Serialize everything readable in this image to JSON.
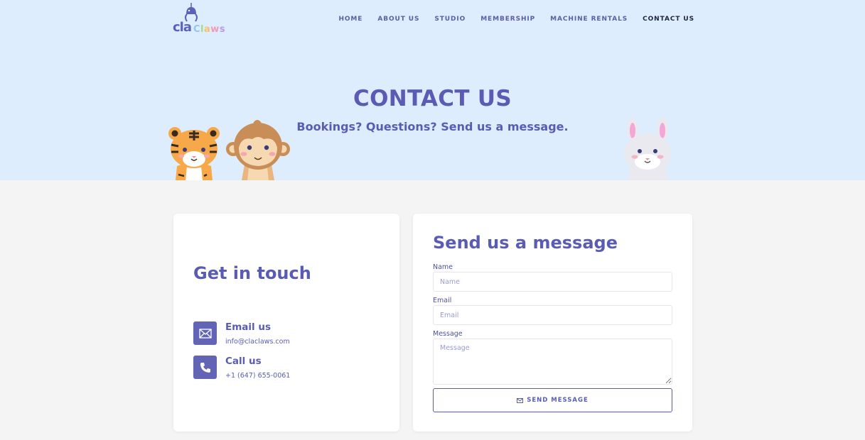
{
  "brand": {
    "logo_part1": "cla",
    "logo_part2_letters": [
      "C",
      "l",
      "a",
      "w",
      "s"
    ]
  },
  "nav": {
    "items": [
      {
        "label": "HOME"
      },
      {
        "label": "ABOUT US"
      },
      {
        "label": "STUDIO"
      },
      {
        "label": "MEMBERSHIP"
      },
      {
        "label": "MACHINE RENTALS"
      },
      {
        "label": "CONTACT US",
        "active": true
      }
    ]
  },
  "hero": {
    "title": "CONTACT US",
    "subtitle": "Bookings? Questions? Send us a message."
  },
  "get_in_touch": {
    "title": "Get in touch",
    "email": {
      "title": "Email us",
      "value": "info@claclaws.com",
      "icon": "envelope-icon"
    },
    "phone": {
      "title": "Call us",
      "value": "+1 (647) 655-0061",
      "icon": "phone-icon"
    }
  },
  "form": {
    "title": "Send us a message",
    "name": {
      "label": "Name",
      "placeholder": "Name"
    },
    "email": {
      "label": "Email",
      "placeholder": "Email"
    },
    "message": {
      "label": "Message",
      "placeholder": "Message"
    },
    "submit_label": "SEND MESSAGE"
  },
  "colors": {
    "accent": "#5a5cb4",
    "hero_bg": "#deedfd",
    "page_bg": "#f4f4f4"
  }
}
